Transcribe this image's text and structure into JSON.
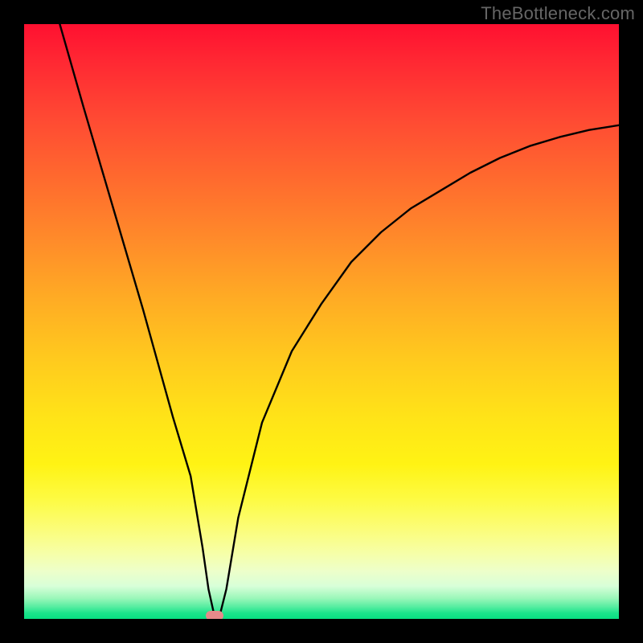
{
  "watermark": "TheBottleneck.com",
  "chart_data": {
    "type": "line",
    "title": "",
    "xlabel": "",
    "ylabel": "",
    "xlim": [
      0,
      100
    ],
    "ylim": [
      0,
      100
    ],
    "series": [
      {
        "name": "bottleneck-curve",
        "x": [
          6,
          10,
          15,
          20,
          25,
          28,
          30,
          31,
          32,
          33,
          34,
          36,
          40,
          45,
          50,
          55,
          60,
          65,
          70,
          75,
          80,
          85,
          90,
          95,
          100
        ],
        "y": [
          100,
          86,
          69,
          52,
          34,
          24,
          12,
          5,
          0.5,
          1,
          5,
          17,
          33,
          45,
          53,
          60,
          65,
          69,
          72,
          75,
          77.5,
          79.5,
          81,
          82.2,
          83
        ]
      }
    ],
    "notch": {
      "x": 32,
      "y": 0.5
    },
    "gradient_stops": [
      {
        "pos": 0,
        "color": "#ff1030"
      },
      {
        "pos": 50,
        "color": "#ffc020"
      },
      {
        "pos": 80,
        "color": "#fdfb60"
      },
      {
        "pos": 100,
        "color": "#08df82"
      }
    ]
  }
}
